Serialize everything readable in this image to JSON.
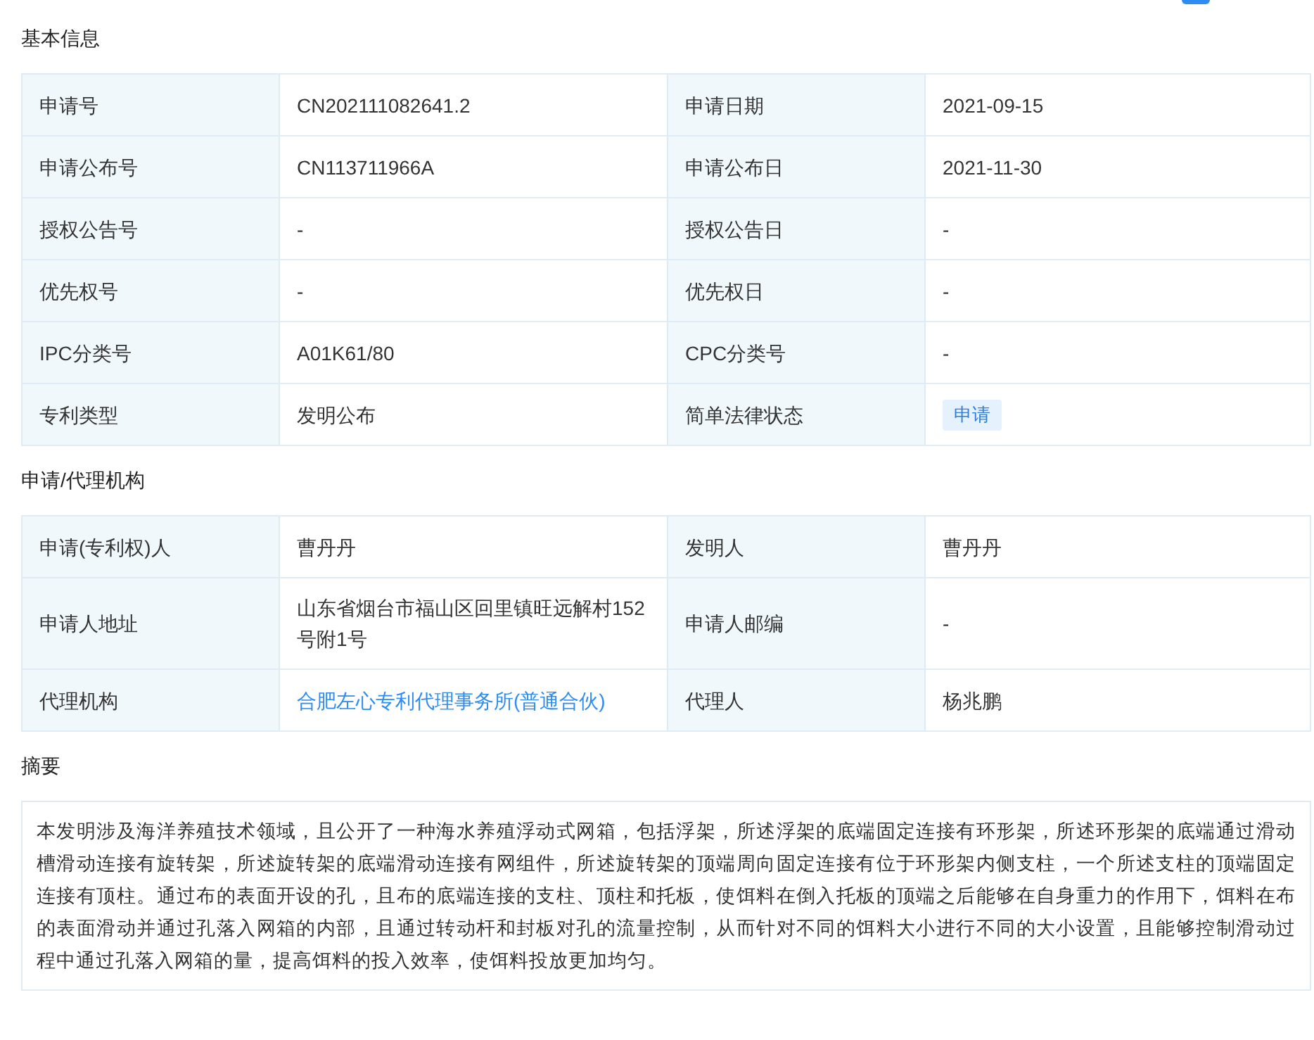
{
  "sections": [
    {
      "title": "基本信息",
      "kind": "grid",
      "rows": [
        [
          {
            "label": "申请号",
            "value": "CN202111082641.2",
            "kind": "text"
          },
          {
            "label": "申请日期",
            "value": "2021-09-15",
            "kind": "text"
          }
        ],
        [
          {
            "label": "申请公布号",
            "value": "CN113711966A",
            "kind": "text"
          },
          {
            "label": "申请公布日",
            "value": "2021-11-30",
            "kind": "text"
          }
        ],
        [
          {
            "label": "授权公告号",
            "value": "-",
            "kind": "text"
          },
          {
            "label": "授权公告日",
            "value": "-",
            "kind": "text"
          }
        ],
        [
          {
            "label": "优先权号",
            "value": "-",
            "kind": "text"
          },
          {
            "label": "优先权日",
            "value": "-",
            "kind": "text"
          }
        ],
        [
          {
            "label": "IPC分类号",
            "value": "A01K61/80",
            "kind": "text"
          },
          {
            "label": "CPC分类号",
            "value": "-",
            "kind": "text"
          }
        ],
        [
          {
            "label": "专利类型",
            "value": "发明公布",
            "kind": "text"
          },
          {
            "label": "简单法律状态",
            "value": "申请",
            "kind": "tag"
          }
        ]
      ]
    },
    {
      "title": "申请/代理机构",
      "kind": "grid",
      "rows": [
        [
          {
            "label": "申请(专利权)人",
            "value": "曹丹丹",
            "kind": "text"
          },
          {
            "label": "发明人",
            "value": "曹丹丹",
            "kind": "text"
          }
        ],
        [
          {
            "label": "申请人地址",
            "value": "山东省烟台市福山区回里镇旺远解村152号附1号",
            "kind": "text"
          },
          {
            "label": "申请人邮编",
            "value": "-",
            "kind": "text"
          }
        ],
        [
          {
            "label": "代理机构",
            "value": "合肥左心专利代理事务所(普通合伙)",
            "kind": "link"
          },
          {
            "label": "代理人",
            "value": "杨兆鹏",
            "kind": "text"
          }
        ]
      ]
    },
    {
      "title": "摘要",
      "kind": "text",
      "body": "本发明涉及海洋养殖技术领域，且公开了一种海水养殖浮动式网箱，包括浮架，所述浮架的底端固定连接有环形架，所述环形架的底端通过滑动槽滑动连接有旋转架，所述旋转架的底端滑动连接有网组件，所述旋转架的顶端周向固定连接有位于环形架内侧支柱，一个所述支柱的顶端固定连接有顶柱。通过布的表面开设的孔，且布的底端连接的支柱、顶柱和托板，使饵料在倒入托板的顶端之后能够在自身重力的作用下，饵料在布的表面滑动并通过孔落入网箱的内部，且通过转动杆和封板对孔的流量控制，从而针对不同的饵料大小进行不同的大小设置，且能够控制滑动过程中通过孔落入网箱的量，提高饵料的投入效率，使饵料投放更加均匀。"
    }
  ]
}
